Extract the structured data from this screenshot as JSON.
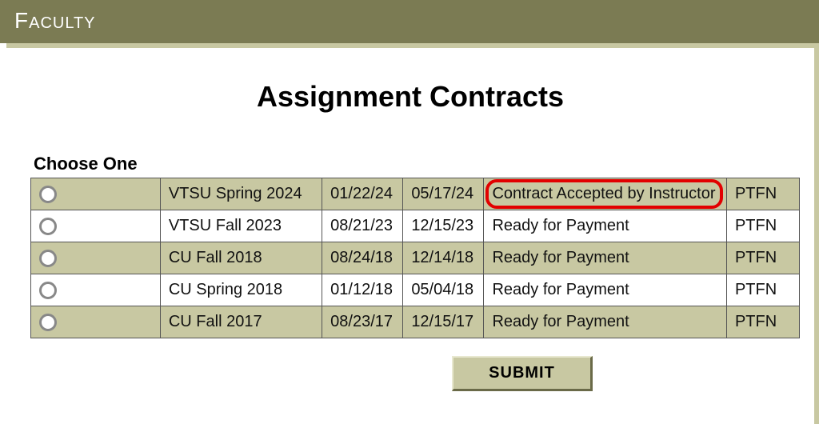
{
  "header": {
    "title": "Faculty"
  },
  "page": {
    "title": "Assignment Contracts",
    "choose_label": "Choose One",
    "submit_label": "SUBMIT"
  },
  "rows": [
    {
      "term": "VTSU Spring 2024",
      "start": "01/22/24",
      "end": "05/17/24",
      "status": "Contract Accepted by Instructor",
      "code": "PTFN",
      "shaded": true,
      "highlight": true
    },
    {
      "term": "VTSU Fall 2023",
      "start": "08/21/23",
      "end": "12/15/23",
      "status": "Ready for Payment",
      "code": "PTFN",
      "shaded": false,
      "highlight": false
    },
    {
      "term": "CU Fall 2018",
      "start": "08/24/18",
      "end": "12/14/18",
      "status": "Ready for Payment",
      "code": "PTFN",
      "shaded": true,
      "highlight": false
    },
    {
      "term": "CU Spring 2018",
      "start": "01/12/18",
      "end": "05/04/18",
      "status": "Ready for Payment",
      "code": "PTFN",
      "shaded": false,
      "highlight": false
    },
    {
      "term": "CU Fall 2017",
      "start": "08/23/17",
      "end": "12/15/17",
      "status": "Ready for Payment",
      "code": "PTFN",
      "shaded": true,
      "highlight": false
    }
  ]
}
